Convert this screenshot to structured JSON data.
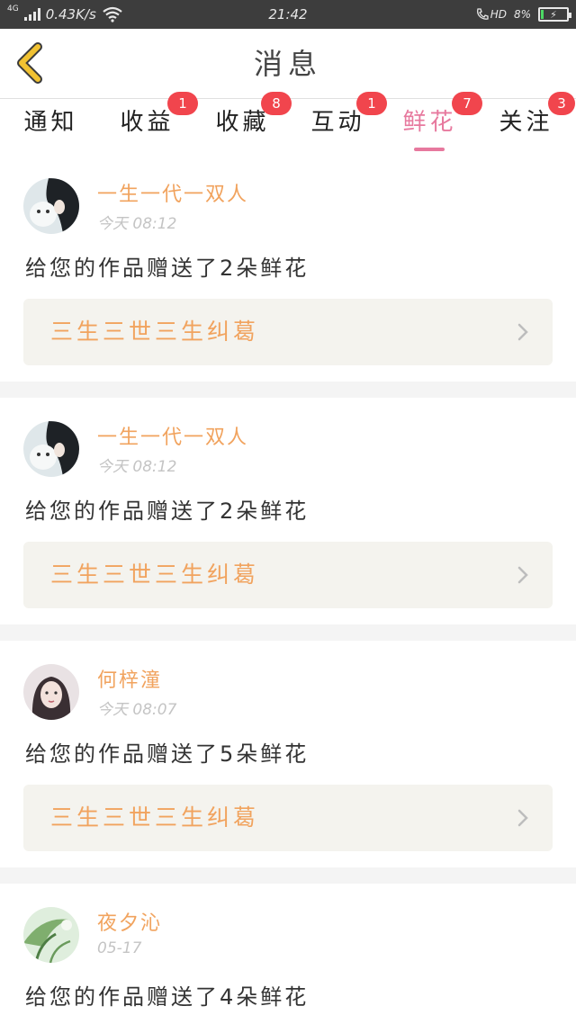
{
  "status_bar": {
    "network_type": "4G",
    "net_speed": "0.43K/s",
    "time": "21:42",
    "hd_label": "HD",
    "battery_percent": "8%",
    "battery_level": 0.08
  },
  "header": {
    "title": "消息",
    "back_icon": "chevron-left-icon",
    "accent_color": "#f1c232"
  },
  "tabs": [
    {
      "label": "通知",
      "badge": "",
      "active": false
    },
    {
      "label": "收益",
      "badge": "1",
      "active": false
    },
    {
      "label": "收藏",
      "badge": "8",
      "active": false
    },
    {
      "label": "互动",
      "badge": "1",
      "active": false
    },
    {
      "label": "鲜花",
      "badge": "7",
      "active": true
    },
    {
      "label": "关注",
      "badge": "3",
      "active": false
    }
  ],
  "colors": {
    "active_tab": "#e7799e",
    "badge": "#f1454d",
    "name": "#f1a35e",
    "work_title": "#f1a35e",
    "work_bg": "#f4f3ee"
  },
  "messages": [
    {
      "name": "一生一代一双人",
      "time": "今天 08:12",
      "text": "给您的作品赠送了2朵鲜花",
      "work": "三生三世三生纠葛"
    },
    {
      "name": "一生一代一双人",
      "time": "今天 08:12",
      "text": "给您的作品赠送了2朵鲜花",
      "work": "三生三世三生纠葛"
    },
    {
      "name": "何梓潼",
      "time": "今天 08:07",
      "text": "给您的作品赠送了5朵鲜花",
      "work": "三生三世三生纠葛"
    },
    {
      "name": "夜夕沁",
      "time": "05-17",
      "text": "给您的作品赠送了4朵鲜花",
      "work": ""
    }
  ]
}
